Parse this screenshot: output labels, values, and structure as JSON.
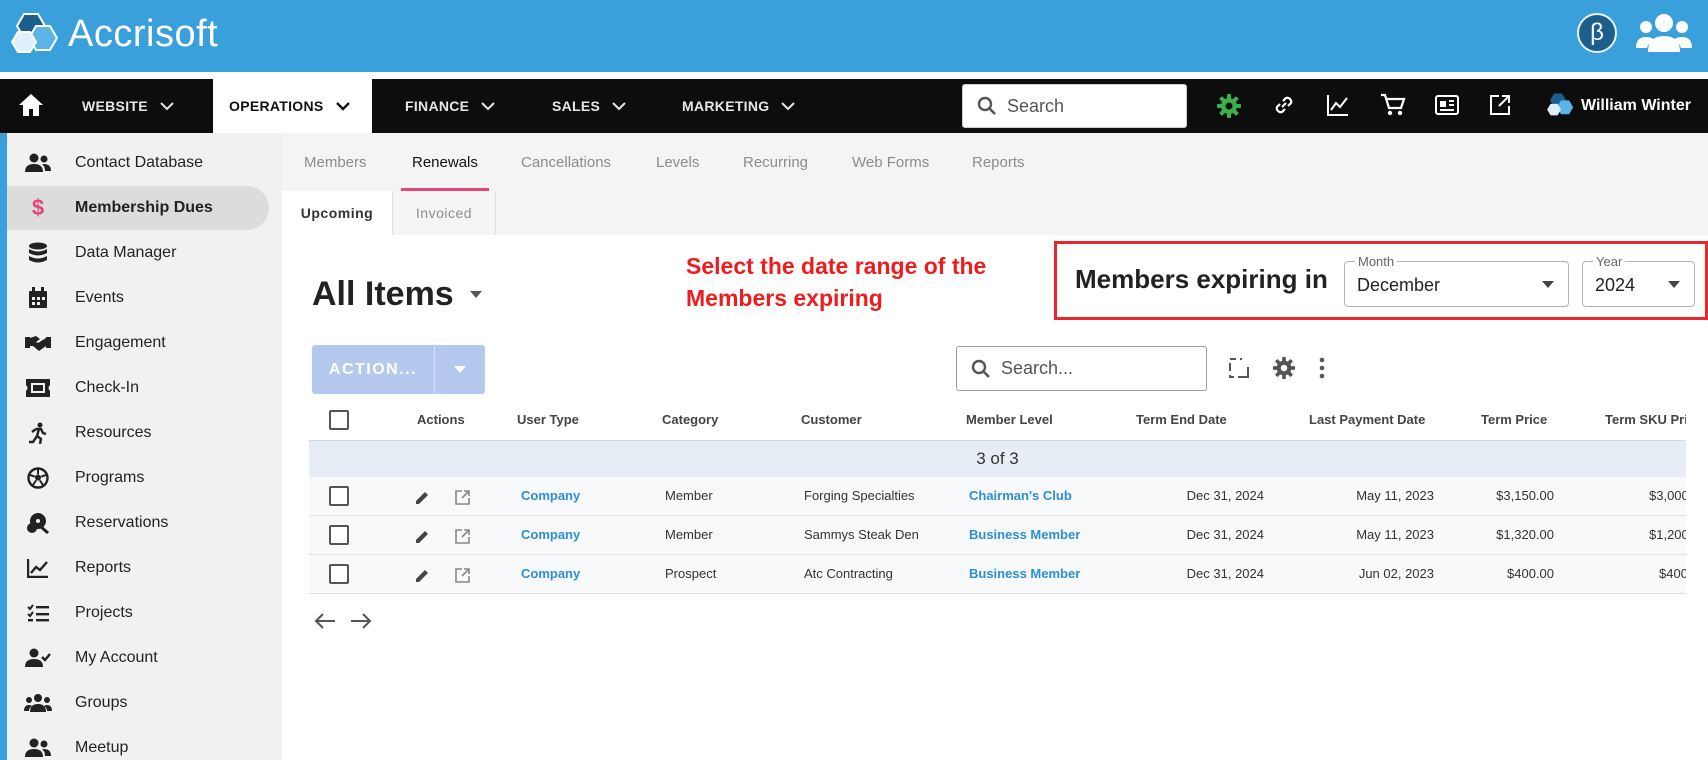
{
  "app": {
    "name": "Accrisoft",
    "beta_badge": "β"
  },
  "nav": {
    "items": [
      {
        "label": "WEBSITE"
      },
      {
        "label": "OPERATIONS"
      },
      {
        "label": "FINANCE"
      },
      {
        "label": "SALES"
      },
      {
        "label": "MARKETING"
      }
    ],
    "search_placeholder": "Search",
    "user_name": "William Winter"
  },
  "sidebar": {
    "items": [
      {
        "label": "Contact Database",
        "icon": "contacts-icon"
      },
      {
        "label": "Membership Dues",
        "icon": "dollar-icon"
      },
      {
        "label": "Data Manager",
        "icon": "database-icon"
      },
      {
        "label": "Events",
        "icon": "calendar-icon"
      },
      {
        "label": "Engagement",
        "icon": "handshake-icon"
      },
      {
        "label": "Check-In",
        "icon": "ticket-icon"
      },
      {
        "label": "Resources",
        "icon": "runner-icon"
      },
      {
        "label": "Programs",
        "icon": "soccer-ball-icon"
      },
      {
        "label": "Reservations",
        "icon": "reservation-icon"
      },
      {
        "label": "Reports",
        "icon": "chart-icon"
      },
      {
        "label": "Projects",
        "icon": "checklist-icon"
      },
      {
        "label": "My Account",
        "icon": "user-check-icon"
      },
      {
        "label": "Groups",
        "icon": "groups-icon"
      },
      {
        "label": "Meetup",
        "icon": "meetup-icon"
      }
    ]
  },
  "subtabs": [
    "Members",
    "Renewals",
    "Cancellations",
    "Levels",
    "Recurring",
    "Web Forms",
    "Reports"
  ],
  "tabs2": [
    "Upcoming",
    "Invoiced"
  ],
  "content": {
    "view_title": "All Items",
    "annotation": "Select the date range of the Members expiring",
    "expiring_label": "Members expiring in",
    "month": {
      "label": "Month",
      "value": "December"
    },
    "year": {
      "label": "Year",
      "value": "2024"
    },
    "action_label": "ACTION...",
    "search_placeholder": "Search..."
  },
  "table": {
    "columns": [
      "Actions",
      "User Type",
      "Category",
      "Customer",
      "Member Level",
      "Term End Date",
      "Last Payment Date",
      "Term Price",
      "Term SKU Pri"
    ],
    "count_text": "3 of 3",
    "rows": [
      {
        "user_type": "Company",
        "category": "Member",
        "customer": "Forging Specialties",
        "level": "Chairman's Club",
        "term_end": "Dec 31, 2024",
        "last_payment": "May 11, 2023",
        "price": "$3,150.00",
        "sku_price": "$3,000"
      },
      {
        "user_type": "Company",
        "category": "Member",
        "customer": "Sammys Steak Den",
        "level": "Business Member",
        "term_end": "Dec 31, 2024",
        "last_payment": "May 11, 2023",
        "price": "$1,320.00",
        "sku_price": "$1,200"
      },
      {
        "user_type": "Company",
        "category": "Prospect",
        "customer": "Atc Contracting",
        "level": "Business Member",
        "term_end": "Dec 31, 2024",
        "last_payment": "Jun 02, 2023",
        "price": "$400.00",
        "sku_price": "$400"
      }
    ]
  },
  "colors": {
    "brand": "#3aa0dc",
    "nav_bg": "#0d0d0d",
    "accent_pink": "#e0457b",
    "link": "#2c8fd3",
    "annotation_red": "#ee1c1c"
  }
}
